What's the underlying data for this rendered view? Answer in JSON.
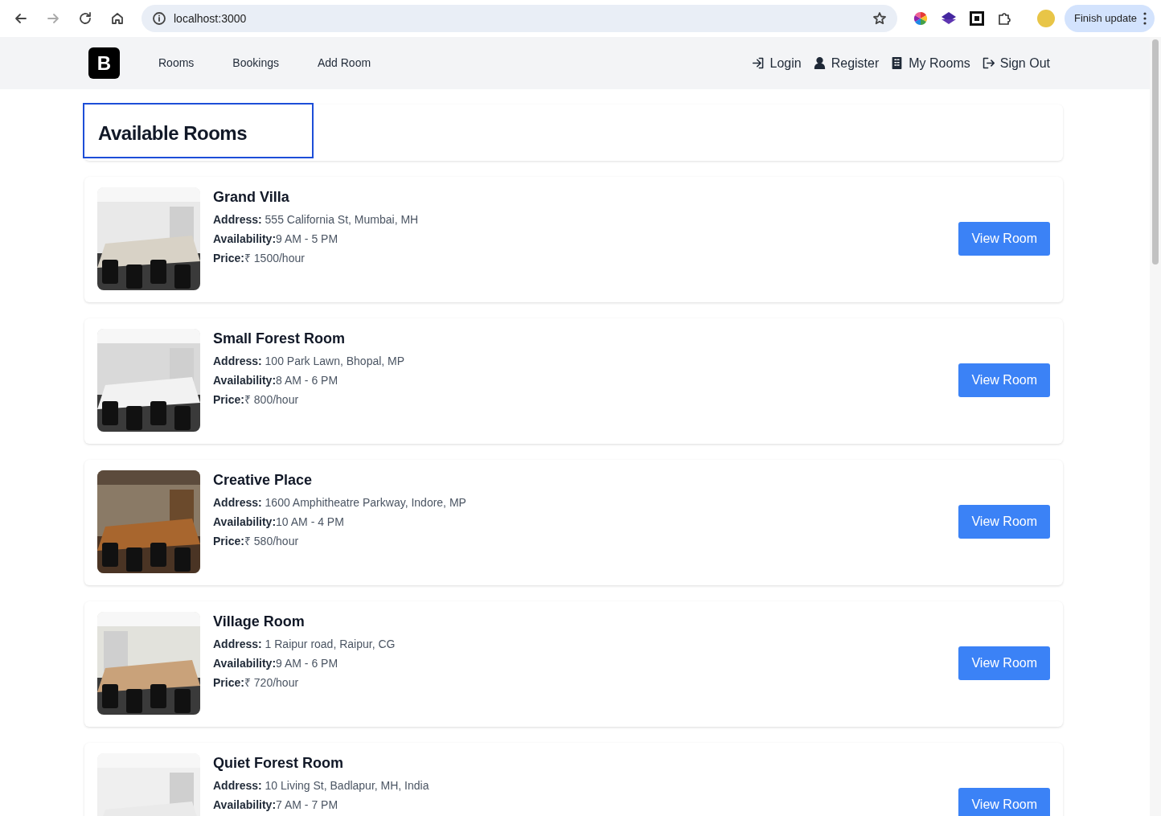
{
  "browser": {
    "url": "localhost:3000",
    "forward_disabled": true,
    "update_button": "Finish update"
  },
  "navbar": {
    "logo": "B",
    "links": [
      {
        "label": "Rooms"
      },
      {
        "label": "Bookings"
      },
      {
        "label": "Add Room"
      }
    ],
    "account_links": [
      {
        "kind": "login",
        "label": "Login"
      },
      {
        "kind": "register",
        "label": "Register"
      },
      {
        "kind": "rooms",
        "label": "My Rooms"
      },
      {
        "kind": "signout",
        "label": "Sign Out"
      }
    ]
  },
  "heading": "Available Rooms",
  "rooms": [
    {
      "name": "Grand Villa",
      "lines": [
        "**Address:** 555 California St, Mumbai, MH",
        "**Availability:**9 AM - 5 PM",
        "**Price:**₹ 1500/hour"
      ],
      "button": "View Room"
    },
    {
      "name": "Small Forest Room",
      "lines": [
        "**Address:** 100 Park Lawn, Bhopal, MP",
        "**Availability:**8 AM - 6 PM",
        "**Price:**₹ 800/hour"
      ],
      "button": "View Room"
    },
    {
      "name": "Creative Place",
      "lines": [
        "**Address:** 1600 Amphitheatre Parkway, Indore, MP",
        "**Availability:**10 AM - 4 PM",
        "**Price:**₹ 580/hour"
      ],
      "button": "View Room"
    },
    {
      "name": "Village Room",
      "lines": [
        "**Address:** 1 Raipur road, Raipur, CG",
        "**Availability:**9 AM - 6 PM",
        "**Price:**₹ 720/hour"
      ],
      "button": "View Room"
    },
    {
      "name": "Quiet Forest Room",
      "lines": [
        "**Address:** 10 Living St, Badlapur, MH, India",
        "**Availability:**7 AM - 7 PM"
      ],
      "button": "View Room"
    }
  ]
}
